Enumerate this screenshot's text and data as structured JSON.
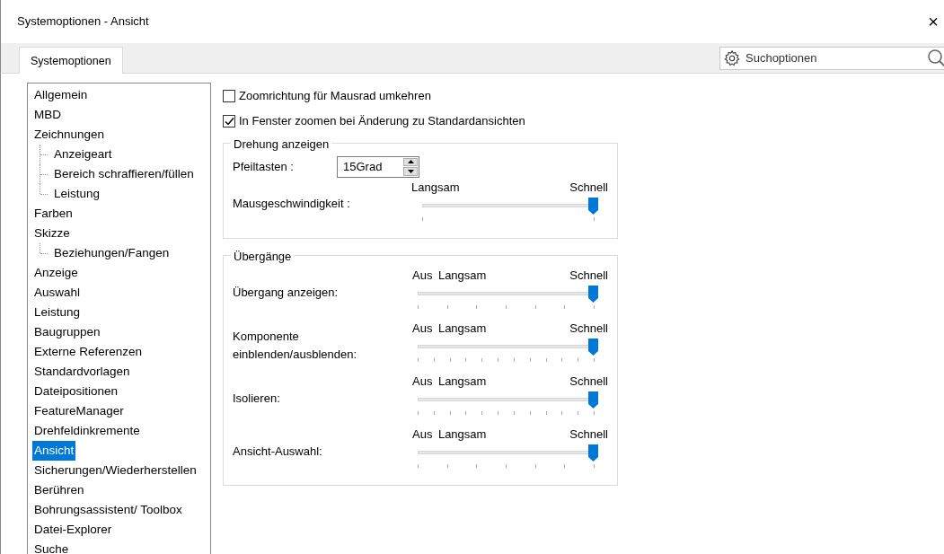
{
  "window": {
    "title": "Systemoptionen - Ansicht",
    "close": "×"
  },
  "tabs": [
    {
      "label": "Systemoptionen",
      "selected": true
    }
  ],
  "search": {
    "placeholder": "Suchoptionen"
  },
  "tree": [
    {
      "label": "Allgemein",
      "selected": false
    },
    {
      "label": "MBD",
      "selected": false
    },
    {
      "label": "Zeichnungen",
      "selected": false,
      "children": [
        {
          "label": "Anzeigeart",
          "selected": false
        },
        {
          "label": "Bereich schraffieren/füllen",
          "selected": false
        },
        {
          "label": "Leistung",
          "selected": false
        }
      ]
    },
    {
      "label": "Farben",
      "selected": false
    },
    {
      "label": "Skizze",
      "selected": false,
      "children": [
        {
          "label": "Beziehungen/Fangen",
          "selected": false
        }
      ]
    },
    {
      "label": "Anzeige",
      "selected": false
    },
    {
      "label": "Auswahl",
      "selected": false
    },
    {
      "label": "Leistung",
      "selected": false
    },
    {
      "label": "Baugruppen",
      "selected": false
    },
    {
      "label": "Externe Referenzen",
      "selected": false
    },
    {
      "label": "Standardvorlagen",
      "selected": false
    },
    {
      "label": "Dateipositionen",
      "selected": false
    },
    {
      "label": "FeatureManager",
      "selected": false
    },
    {
      "label": "Drehfeldinkremente",
      "selected": false
    },
    {
      "label": "Ansicht",
      "selected": true
    },
    {
      "label": "Sicherungen/Wiederherstellen",
      "selected": false
    },
    {
      "label": "Berühren",
      "selected": false
    },
    {
      "label": "Bohrungsassistent/ Toolbox",
      "selected": false
    },
    {
      "label": "Datei-Explorer",
      "selected": false
    },
    {
      "label": "Suche",
      "selected": false
    }
  ],
  "checkboxes": [
    {
      "label": "Zoomrichtung für Mausrad umkehren",
      "checked": false
    },
    {
      "label": "In Fenster zoomen bei Änderung zu Standardansichten",
      "checked": true
    }
  ],
  "rotation": {
    "title": "Drehung anzeigen",
    "arrow_keys": {
      "label": "Pfeiltasten :",
      "value": "15Grad"
    },
    "mouse_speed": {
      "label": "Mausgeschwindigkeit :",
      "low": "Langsam",
      "high": "Schnell",
      "level": 1
    }
  },
  "transitions": {
    "title": "Übergänge",
    "sliders": [
      {
        "label": "Übergang anzeigen:",
        "off": "Aus",
        "low": "Langsam",
        "high": "Schnell",
        "level": 1,
        "kind": "coarse"
      },
      {
        "label": "Komponente einblenden/ausblenden:",
        "off": "Aus",
        "low": "Langsam",
        "high": "Schnell",
        "level": 1,
        "kind": "fine"
      },
      {
        "label": "Isolieren:",
        "off": "Aus",
        "low": "Langsam",
        "high": "Schnell",
        "level": 1,
        "kind": "fine"
      },
      {
        "label": "Ansicht-Auswahl:",
        "off": "Aus",
        "low": "Langsam",
        "high": "Schnell",
        "level": 1,
        "kind": "coarse"
      }
    ]
  }
}
